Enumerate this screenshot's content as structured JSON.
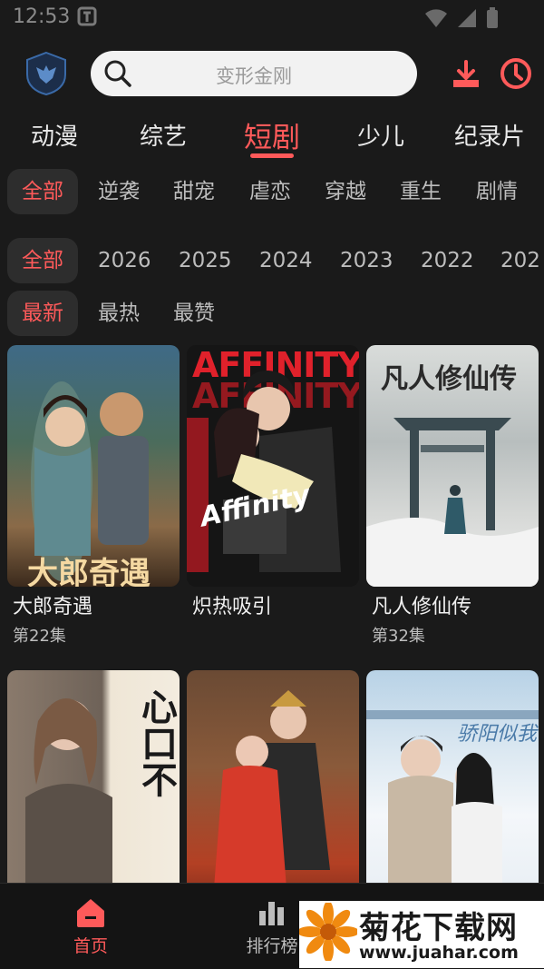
{
  "status": {
    "time": "12:53"
  },
  "search": {
    "placeholder": "变形金刚"
  },
  "tabs": [
    {
      "label": "动漫"
    },
    {
      "label": "综艺"
    },
    {
      "label": "短剧",
      "active": true
    },
    {
      "label": "少儿"
    },
    {
      "label": "纪录片"
    }
  ],
  "genres": [
    "全部",
    "逆袭",
    "甜宠",
    "虐恋",
    "穿越",
    "重生",
    "剧情"
  ],
  "years": [
    "全部",
    "2026",
    "2025",
    "2024",
    "2023",
    "2022",
    "202"
  ],
  "sorts": [
    "最新",
    "最热",
    "最赞"
  ],
  "cards": [
    {
      "title": "大郎奇遇",
      "episode": "第22集",
      "overlay": "大郎奇遇"
    },
    {
      "title": "炽热吸引",
      "episode": "",
      "overlay": "AFFINITY",
      "overlay2": "Affinity"
    },
    {
      "title": "凡人修仙传",
      "episode": "第32集",
      "overlay": "凡人修仙传"
    },
    {
      "title": "",
      "episode": "",
      "overlay": "心口不"
    },
    {
      "title": "",
      "episode": "",
      "overlay": ""
    },
    {
      "title": "",
      "episode": "",
      "overlay": "骄阳似我"
    }
  ],
  "bottom_nav": [
    {
      "label": "首页",
      "icon": "home-icon",
      "active": true
    },
    {
      "label": "排行榜",
      "icon": "ranking-icon"
    }
  ],
  "watermark": {
    "title": "菊花下载网",
    "url": "www.juahar.com"
  },
  "colors": {
    "accent": "#ff5a5a",
    "background": "#1a1a1a",
    "chip_bg": "#2d2d2d"
  }
}
